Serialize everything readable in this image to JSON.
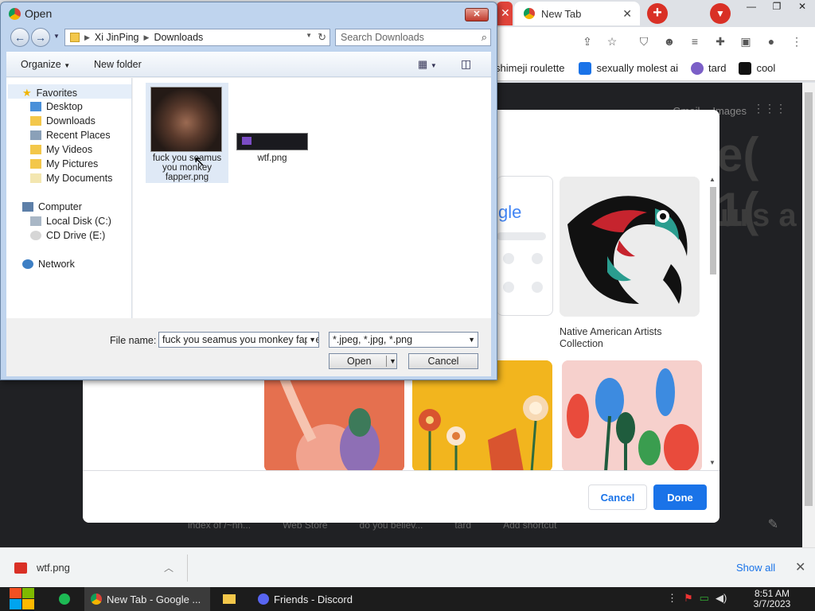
{
  "chrome": {
    "active_tab_title": "New Tab",
    "bookmarks": [
      {
        "label": "shimeji roulette",
        "color": "#e0443a"
      },
      {
        "label": "sexually molest ai",
        "color": "#1a73e8"
      },
      {
        "label": "tard",
        "color": "#7b5fc7"
      },
      {
        "label": "cool",
        "color": "#111111"
      }
    ],
    "ntp_links": [
      "Gmail",
      "Images"
    ],
    "bigtext_1": "e( 1(",
    "bigtext_2": "urs a",
    "shortcuts": [
      "index of /~nn...",
      "Web Store",
      "do you believ...",
      "tard",
      "Add shortcut"
    ]
  },
  "customize": {
    "google_logo": "gle",
    "native_title": "Native American Artists Collection",
    "cancel_label": "Cancel",
    "done_label": "Done"
  },
  "open_dialog": {
    "title": "Open",
    "breadcrumb": [
      "Xi JinPing",
      "Downloads"
    ],
    "search_placeholder": "Search Downloads",
    "organize_label": "Organize",
    "new_folder_label": "New folder",
    "tree": {
      "favorites": "Favorites",
      "fav_items": [
        "Desktop",
        "Downloads",
        "Recent Places",
        "My Videos",
        "My Pictures",
        "My Documents"
      ],
      "computer": "Computer",
      "drives": [
        "Local Disk (C:)",
        "CD Drive (E:)"
      ],
      "network": "Network"
    },
    "files": [
      {
        "name": "fuck you seamus you monkey fapper.png"
      },
      {
        "name": "wtf.png"
      }
    ],
    "file_name_label": "File name:",
    "file_name_value": "fuck you seamus you monkey fapper.png",
    "file_type": "*.jpeg, *.jpg, *.png",
    "open_label": "Open",
    "cancel_label": "Cancel"
  },
  "download_bar": {
    "item": "wtf.png",
    "show_all": "Show all"
  },
  "taskbar": {
    "apps": [
      "New Tab - Google ...",
      "Friends - Discord"
    ],
    "time": "8:51 AM",
    "date": "3/7/2023"
  }
}
